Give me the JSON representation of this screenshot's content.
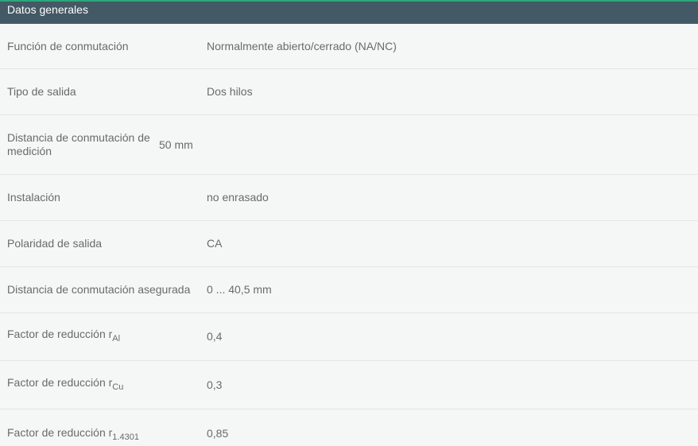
{
  "header": {
    "title": "Datos generales"
  },
  "rows": [
    {
      "label": "Función de conmutación",
      "value": "Normalmente abierto/cerrado (NA/NC)"
    },
    {
      "label": "Tipo de salida",
      "value": "Dos hilos"
    },
    {
      "label": "Distancia de conmutación de medición",
      "value": "50 mm"
    },
    {
      "label": "Instalación",
      "value": "no enrasado"
    },
    {
      "label": "Polaridad de salida",
      "value": "CA"
    },
    {
      "label": "Distancia de conmutación asegurada",
      "value": "0 ... 40,5 mm"
    },
    {
      "label": "Factor de reducción r",
      "sub": "Al",
      "value": "0,4"
    },
    {
      "label": "Factor de reducción r",
      "sub": "Cu",
      "value": "0,3"
    },
    {
      "label": "Factor de reducción r",
      "sub": "1.4301",
      "value": "0,85"
    }
  ],
  "colors": {
    "header_bg": "#435966",
    "accent_line": "#2aa878",
    "background": "#f5f7f6",
    "text": "#6a6a6a"
  }
}
